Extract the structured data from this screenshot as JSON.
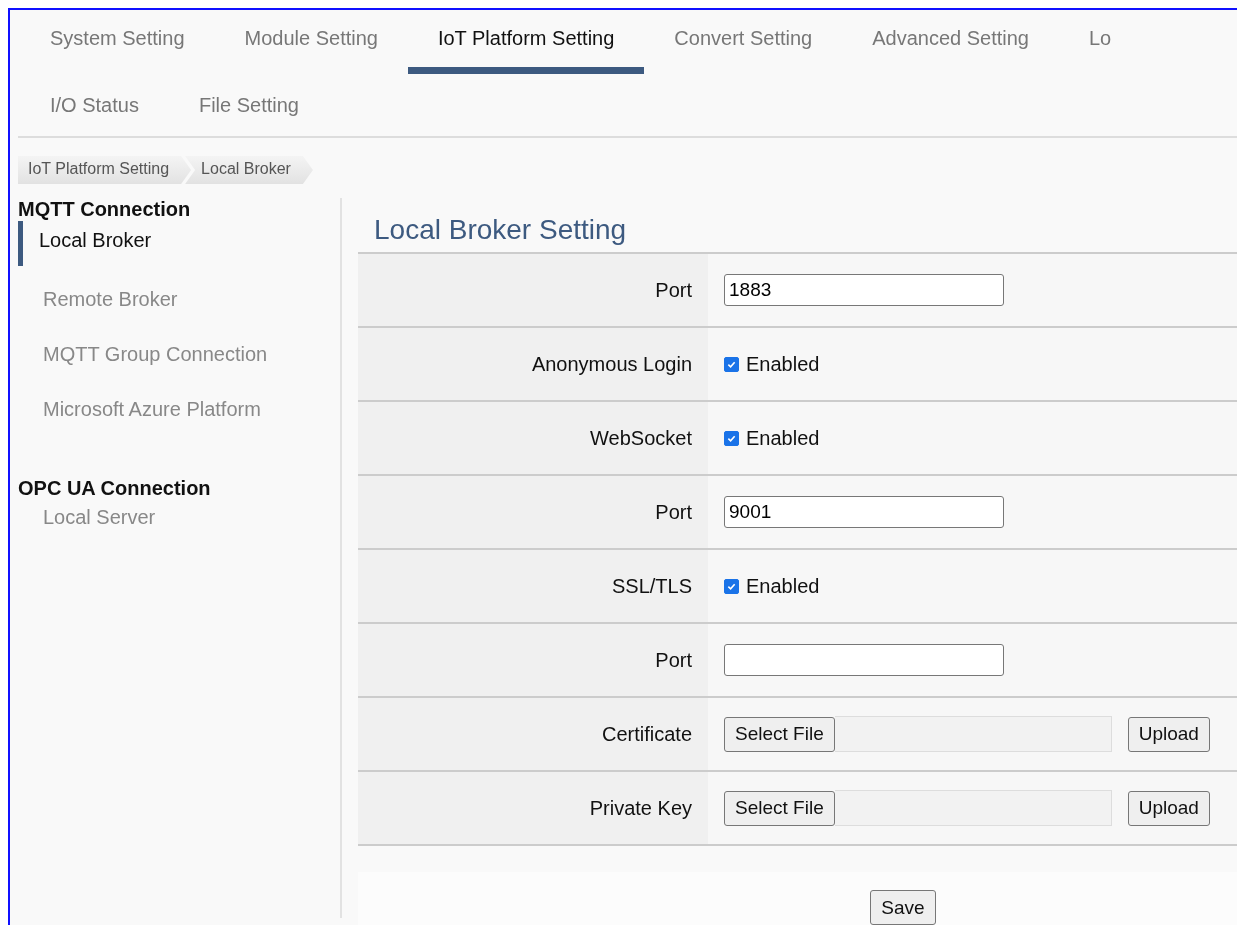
{
  "tabs": [
    {
      "label": "System Setting",
      "selected": false
    },
    {
      "label": "Module Setting",
      "selected": false
    },
    {
      "label": "IoT Platform Setting",
      "selected": true
    },
    {
      "label": "Convert Setting",
      "selected": false
    },
    {
      "label": "Advanced Setting",
      "selected": false
    },
    {
      "label": "Lo",
      "selected": false
    }
  ],
  "tabs_row_2": [
    {
      "label": "I/O Status",
      "selected": false
    },
    {
      "label": "File Setting",
      "selected": false
    }
  ],
  "breadcrumb": [
    "IoT Platform Setting",
    "Local Broker"
  ],
  "sidebar": {
    "groups": [
      {
        "heading": "MQTT Connection",
        "items": [
          {
            "label": "Local Broker",
            "selected": true
          },
          {
            "label": "Remote Broker",
            "selected": false
          },
          {
            "label": "MQTT Group Connection",
            "selected": false
          },
          {
            "label": "Microsoft Azure Platform",
            "selected": false
          }
        ]
      },
      {
        "heading": "OPC UA Connection",
        "items": [
          {
            "label": "Local Server",
            "selected": false
          }
        ]
      }
    ]
  },
  "form": {
    "title": "Local Broker Setting",
    "rows": [
      {
        "kind": "text",
        "label": "Port",
        "value": "1883"
      },
      {
        "kind": "checkbox",
        "label": "Anonymous Login",
        "option": "Enabled",
        "checked": true
      },
      {
        "kind": "checkbox",
        "label": "WebSocket",
        "option": "Enabled",
        "checked": true
      },
      {
        "kind": "text",
        "label": "Port",
        "value": "9001"
      },
      {
        "kind": "checkbox",
        "label": "SSL/TLS",
        "option": "Enabled",
        "checked": true
      },
      {
        "kind": "text",
        "label": "Port"
      },
      {
        "kind": "file",
        "label": "Certificate",
        "select_button": "Select File",
        "upload_button": "Upload"
      },
      {
        "kind": "file",
        "label": "Private Key",
        "select_button": "Select File",
        "upload_button": "Upload"
      }
    ],
    "save_button": "Save"
  }
}
